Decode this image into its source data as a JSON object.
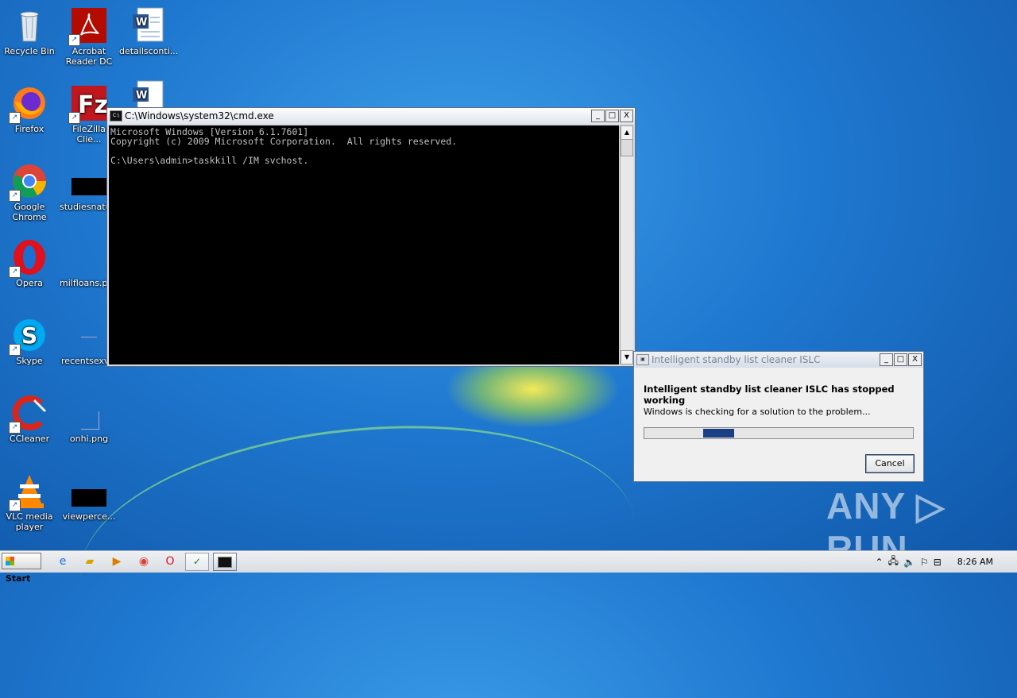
{
  "desktop": {
    "icons": [
      {
        "label": "Recycle Bin",
        "icon": "recycle-bin-icon"
      },
      {
        "label": "Acrobat Reader DC",
        "icon": "acrobat-icon"
      },
      {
        "label": "detailsconti...",
        "icon": "word-doc-icon"
      },
      {
        "label": "Firefox",
        "icon": "firefox-icon"
      },
      {
        "label": "FileZilla Clie...",
        "icon": "filezilla-icon"
      },
      {
        "label": "",
        "icon": "word-doc-icon"
      },
      {
        "label": "Google Chrome",
        "icon": "chrome-icon"
      },
      {
        "label": "studiesnatu...",
        "icon": "file-thumbnail-icon"
      },
      {
        "label": "Opera",
        "icon": "opera-icon"
      },
      {
        "label": "milfloans.pr...",
        "icon": "file-icon"
      },
      {
        "label": "Skype",
        "icon": "skype-icon"
      },
      {
        "label": "recentsexv...",
        "icon": "file-icon"
      },
      {
        "label": "CCleaner",
        "icon": "ccleaner-icon"
      },
      {
        "label": "onhi.png",
        "icon": "image-file-icon"
      },
      {
        "label": "VLC media player",
        "icon": "vlc-icon"
      },
      {
        "label": "viewperce...",
        "icon": "file-thumbnail-icon"
      }
    ]
  },
  "cmd_window": {
    "title": "C:\\Windows\\system32\\cmd.exe",
    "lines": [
      "Microsoft Windows [Version 6.1.7601]",
      "Copyright (c) 2009 Microsoft Corporation.  All rights reserved.",
      "",
      "C:\\Users\\admin>taskkill /IM svchost."
    ],
    "min_label": "_",
    "max_label": "□",
    "close_label": "X"
  },
  "dialog": {
    "title": "Intelligent standby list cleaner ISLC",
    "heading": "Intelligent standby list cleaner ISLC has stopped working",
    "message": "Windows is checking for a solution to the problem...",
    "cancel_label": "Cancel",
    "min_label": "_",
    "max_label": "□",
    "close_label": "X"
  },
  "taskbar": {
    "start_label": "Start",
    "quick_launch": [
      "ie-icon",
      "explorer-icon",
      "media-player-icon",
      "chrome-icon",
      "opera-icon"
    ],
    "tasks": [
      "islc-task-icon",
      "cmd-task-icon"
    ],
    "tray_icons": [
      "show-hidden-icons-icon",
      "network-icon",
      "volume-icon",
      "action-center-icon",
      "flag-icon"
    ],
    "clock": "8:26 AM"
  },
  "watermark": "ANY ▷ RUN"
}
